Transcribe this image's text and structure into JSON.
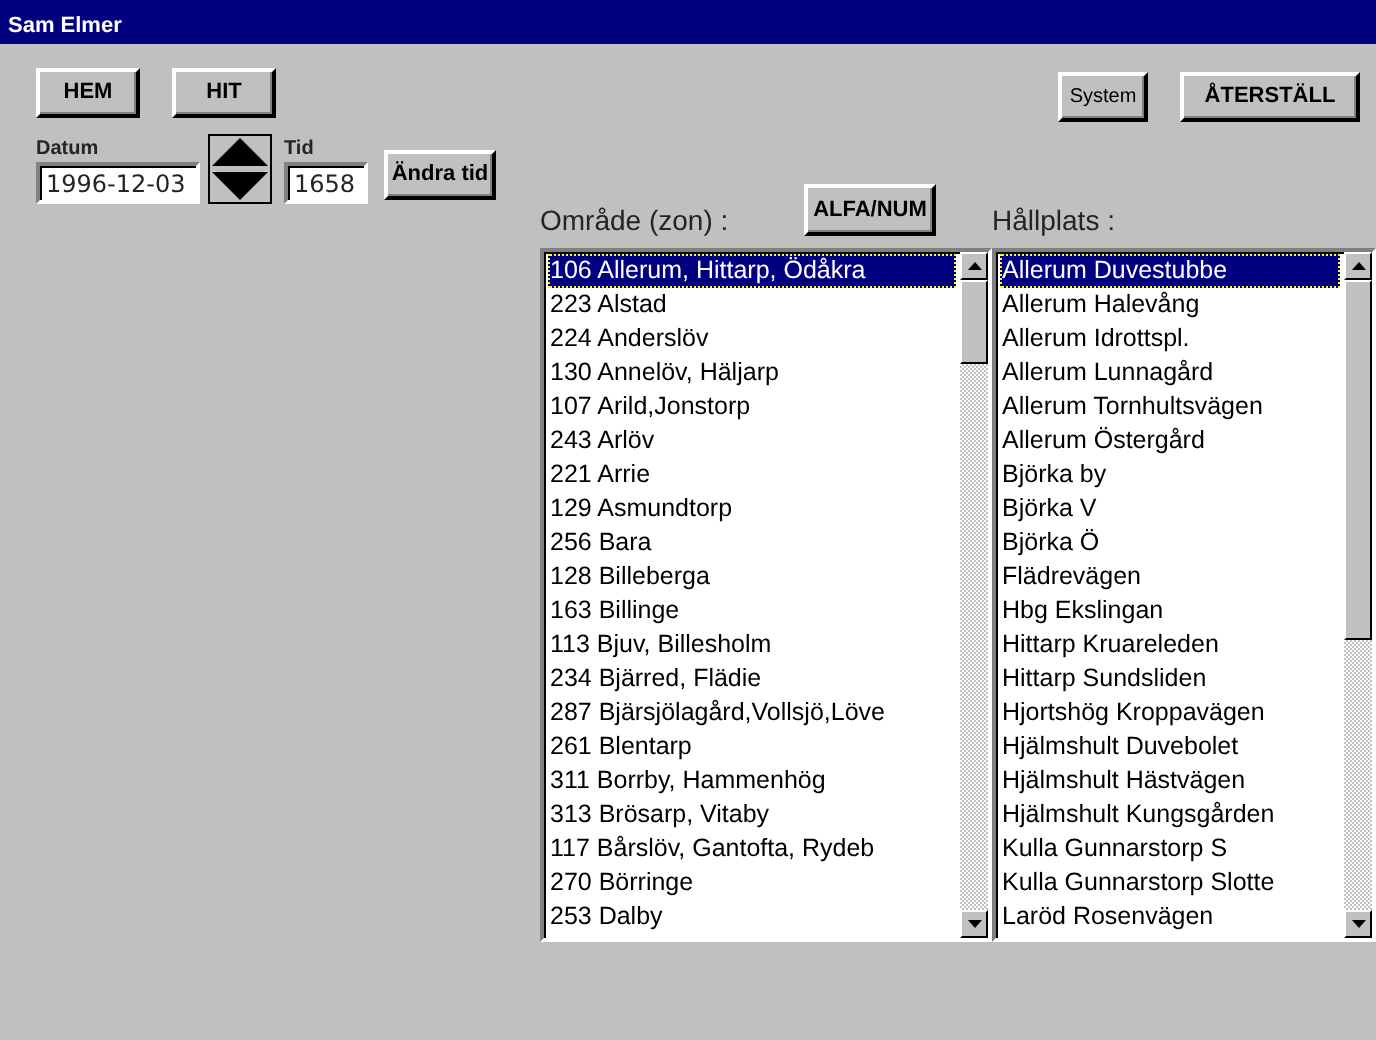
{
  "window": {
    "title": "Sam Elmer"
  },
  "top_buttons": [
    {
      "label": "HEM"
    },
    {
      "label": "HIT"
    }
  ],
  "right_buttons": [
    {
      "label": "System",
      "kind": "small"
    },
    {
      "label": "ÅTERSTÄLL",
      "kind": "bold"
    }
  ],
  "date_field": {
    "label": "Datum",
    "value": "1996-12-03"
  },
  "time_field": {
    "label": "Tid",
    "value": "1658"
  },
  "change_time_button": {
    "label": "Ändra tid"
  },
  "sort_button": {
    "label": "ALFA/NUM"
  },
  "zone_list": {
    "label": "Område (zon) :",
    "items": [
      {
        "text": "106 Allerum, Hittarp, Ödåkra",
        "selected": true
      },
      {
        "text": "223 Alstad",
        "selected": false
      },
      {
        "text": "224 Anderslöv",
        "selected": false
      },
      {
        "text": "130 Annelöv, Häljarp",
        "selected": false
      },
      {
        "text": "107 Arild,Jonstorp",
        "selected": false
      },
      {
        "text": "243 Arlöv",
        "selected": false
      },
      {
        "text": "221 Arrie",
        "selected": false
      },
      {
        "text": "129 Asmundtorp",
        "selected": false
      },
      {
        "text": "256 Bara",
        "selected": false
      },
      {
        "text": "128 Billeberga",
        "selected": false
      },
      {
        "text": "163 Billinge",
        "selected": false
      },
      {
        "text": "113 Bjuv, Billesholm",
        "selected": false
      },
      {
        "text": "234 Bjärred, Flädie",
        "selected": false
      },
      {
        "text": "287 Bjärsjölagård,Vollsjö,Löve",
        "selected": false
      },
      {
        "text": "261 Blentarp",
        "selected": false
      },
      {
        "text": "311 Borrby, Hammenhög",
        "selected": false
      },
      {
        "text": "313 Brösarp, Vitaby",
        "selected": false
      },
      {
        "text": "117 Bårslöv, Gantofta, Rydeb",
        "selected": false
      },
      {
        "text": "270 Börringe",
        "selected": false
      },
      {
        "text": "253 Dalby",
        "selected": false
      }
    ]
  },
  "stop_list": {
    "label": "Hållplats :",
    "items": [
      {
        "text": "Allerum Duvestubbe",
        "selected": true
      },
      {
        "text": "Allerum Halevång",
        "selected": false
      },
      {
        "text": "Allerum Idrottspl.",
        "selected": false
      },
      {
        "text": "Allerum Lunnagård",
        "selected": false
      },
      {
        "text": "Allerum Tornhultsvägen",
        "selected": false
      },
      {
        "text": "Allerum Östergård",
        "selected": false
      },
      {
        "text": "Björka by",
        "selected": false
      },
      {
        "text": "Björka V",
        "selected": false
      },
      {
        "text": "Björka Ö",
        "selected": false
      },
      {
        "text": "Flädrevägen",
        "selected": false
      },
      {
        "text": "Hbg Ekslingan",
        "selected": false
      },
      {
        "text": "Hittarp Kruareleden",
        "selected": false
      },
      {
        "text": "Hittarp Sundsliden",
        "selected": false
      },
      {
        "text": "Hjortshög Kroppavägen",
        "selected": false
      },
      {
        "text": "Hjälmshult Duvebolet",
        "selected": false
      },
      {
        "text": "Hjälmshult Hästvägen",
        "selected": false
      },
      {
        "text": "Hjälmshult Kungsgården",
        "selected": false
      },
      {
        "text": "Kulla Gunnarstorp S",
        "selected": false
      },
      {
        "text": "Kulla Gunnarstorp Slotte",
        "selected": false
      },
      {
        "text": "Laröd Rosenvägen",
        "selected": false
      }
    ]
  }
}
